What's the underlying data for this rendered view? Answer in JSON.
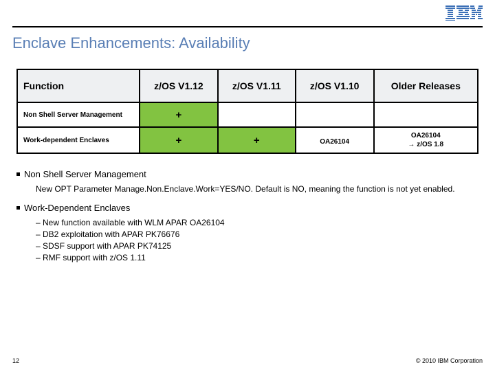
{
  "header": {
    "logo_alt": "IBM"
  },
  "title": "Enclave Enhancements: Availability",
  "table": {
    "columns": [
      "Function",
      "z/OS V1.12",
      "z/OS V1.11",
      "z/OS V1.10",
      "Older Releases"
    ],
    "rows": [
      {
        "label": "Non Shell Server Management",
        "cells": [
          "+",
          "",
          "",
          ""
        ],
        "green": [
          true,
          false,
          false,
          false
        ]
      },
      {
        "label": "Work-dependent Enclaves",
        "cells": [
          "+",
          "+",
          "OA26104",
          "OA26104\n→ z/OS 1.8"
        ],
        "green": [
          true,
          true,
          false,
          false
        ]
      }
    ]
  },
  "sections": [
    {
      "heading": "Non Shell Server Management",
      "desc": "New OPT Parameter Manage.Non.Enclave.Work=YES/NO. Default is NO, meaning the function is not yet enabled."
    },
    {
      "heading": "Work-Dependent Enclaves",
      "items": [
        "New function available with WLM APAR OA26104",
        "DB2 exploitation with APAR PK76676",
        "SDSF support with APAR PK74125",
        "RMF support with z/OS 1.11"
      ]
    }
  ],
  "footer": {
    "page": "12",
    "copyright": "© 2010 IBM Corporation"
  },
  "chart_data": {
    "type": "table",
    "title": "Enclave Enhancements: Availability",
    "columns": [
      "Function",
      "z/OS V1.12",
      "z/OS V1.11",
      "z/OS V1.10",
      "Older Releases"
    ],
    "rows": [
      [
        "Non Shell Server Management",
        "+",
        "",
        "",
        ""
      ],
      [
        "Work-dependent Enclaves",
        "+",
        "+",
        "OA26104",
        "OA26104 → z/OS 1.8"
      ]
    ]
  }
}
